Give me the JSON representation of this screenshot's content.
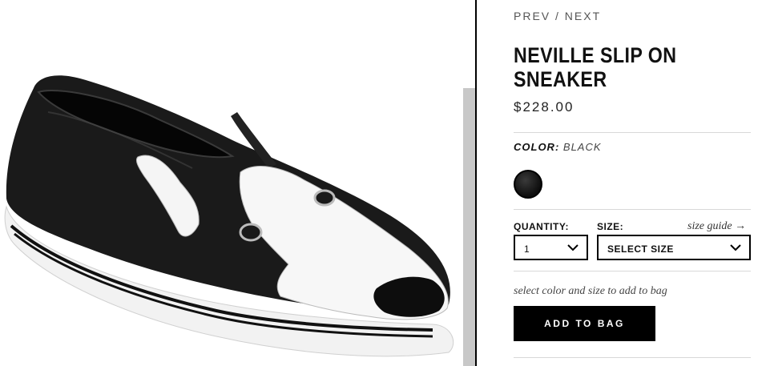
{
  "nav": {
    "prev_label": "PREV",
    "separator": "/",
    "next_label": "NEXT"
  },
  "product": {
    "title": "NEVILLE SLIP ON SNEAKER",
    "price": "$228.00",
    "image_alt": "Black slip-on sneaker with white dog face design"
  },
  "color": {
    "label": "COLOR:",
    "value": "BLACK",
    "swatches": [
      {
        "name": "Black",
        "hex": "#111111",
        "selected": true
      }
    ]
  },
  "quantity": {
    "label": "QUANTITY:",
    "value": "1"
  },
  "size": {
    "label": "SIZE:",
    "value": "SELECT SIZE",
    "guide_label": "size guide →"
  },
  "cart": {
    "hint": "select color and size to add to bag",
    "button_label": "ADD TO BAG"
  },
  "colors": {
    "accent": "#000000",
    "divider": "#d8d8d8",
    "scrollbar_thumb": "#c8c8c8"
  }
}
